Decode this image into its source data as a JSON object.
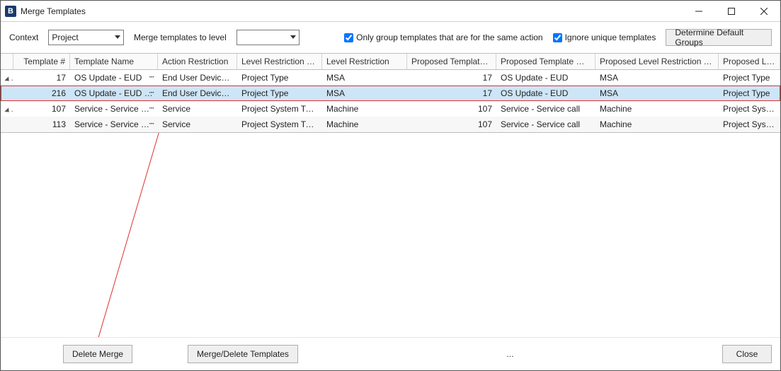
{
  "window": {
    "title": "Merge Templates"
  },
  "toolbar": {
    "context_label": "Context",
    "context_value": "Project",
    "merge_level_label": "Merge templates to level",
    "merge_level_value": "",
    "only_group_label": "Only group templates that are for the same action",
    "only_group_checked": true,
    "ignore_unique_label": "Ignore unique templates",
    "ignore_unique_checked": true,
    "determine_btn": "Determine Default Groups"
  },
  "columns": {
    "template_num": "Template #",
    "template_name": "Template Name",
    "action_restriction": "Action Restriction",
    "level_restriction_type": "Level Restriction Type",
    "level_restriction": "Level Restriction",
    "proposed_num": "Proposed Template #",
    "proposed_name": "Proposed Template Name",
    "proposed_lrt": "Proposed Level Restriction Type",
    "proposed_lr": "Proposed Level Restriction"
  },
  "rows": [
    {
      "expander": true,
      "num": "17",
      "name": "OS Update - EUD",
      "action": "End User Device HW",
      "lrt": "Project Type",
      "lr": "MSA",
      "pnum": "17",
      "pname": "OS Update - EUD",
      "plrt": "MSA",
      "plr": "Project Type",
      "selected": false
    },
    {
      "expander": false,
      "num": "216",
      "name": "OS Update - EUD (Copy",
      "action": "End User Device HW",
      "lrt": "Project Type",
      "lr": "MSA",
      "pnum": "17",
      "pname": "OS Update - EUD",
      "plrt": "MSA",
      "plr": "Project Type",
      "selected": true
    },
    {
      "expander": true,
      "num": "107",
      "name": "Service - Service call",
      "action": "Service",
      "lrt": "Project System Type",
      "lr": "Machine",
      "pnum": "107",
      "pname": "Service - Service call",
      "plrt": "Machine",
      "plr": "Project System Type",
      "selected": false
    },
    {
      "expander": false,
      "num": "113",
      "name": "Service - Service call (C",
      "action": "Service",
      "lrt": "Project System Type",
      "lr": "Machine",
      "pnum": "107",
      "pname": "Service - Service call",
      "plrt": "Machine",
      "plr": "Project System Type",
      "selected": false
    }
  ],
  "footer": {
    "delete_merge": "Delete Merge",
    "merge_delete_templates": "Merge/Delete Templates",
    "ellipsis": "...",
    "close": "Close"
  }
}
